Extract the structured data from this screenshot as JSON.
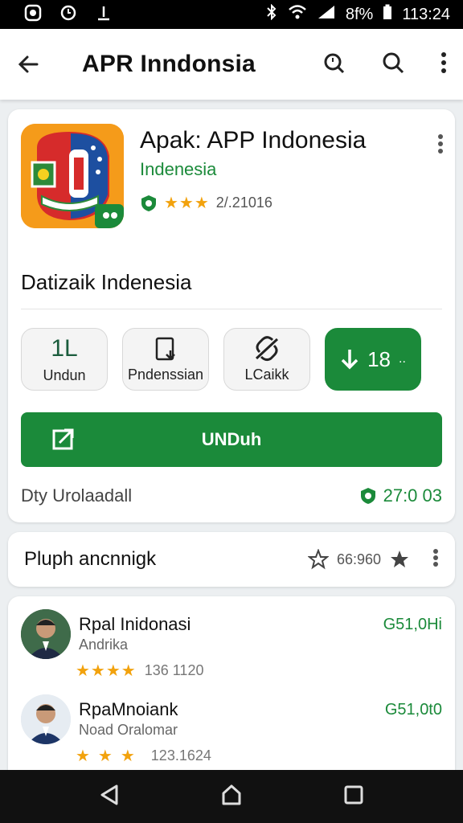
{
  "status_bar": {
    "time": "113:24",
    "battery": "8f%",
    "left_icons": [
      "shield-icon",
      "circle-icon",
      "download-icon"
    ],
    "right_icons": [
      "bluetooth-icon",
      "wifi-icon",
      "signal-icon",
      "battery-icon"
    ]
  },
  "toolbar": {
    "title": "APR Inndonsia"
  },
  "app": {
    "title": "Apak: APP Indonesia",
    "developer": "Indenesia",
    "rating_count": "2/.21016",
    "stars": 3,
    "description": "Datizaik Indenesia",
    "tiles": [
      {
        "value": "1L",
        "label": "Undun"
      },
      {
        "icon": "tablet-download-icon",
        "label": "Pndenssian"
      },
      {
        "icon": "no-link-icon",
        "label": "LCaikk"
      },
      {
        "value": "18",
        "suffix": ".."
      }
    ],
    "install_label": "UNDuh",
    "footer_left": "Dty Urolaadall",
    "footer_right": "27:0 03"
  },
  "sort_bar": {
    "label": "Pluph ancnnigk",
    "count": "66:960"
  },
  "reviews": [
    {
      "name": "Rpal Inidonasi",
      "subtitle": "Andrika",
      "rating_text": "136 1120",
      "price": "G51,0Hi",
      "stars": 4
    },
    {
      "name": "RpaMnoiank",
      "subtitle": "Noad Oralomar",
      "rating_text": "123.1624",
      "price": "G51,0t0",
      "stars": 3
    }
  ],
  "colors": {
    "accent": "#1b8a3a",
    "star": "#f2a20d",
    "icon_bg": "#f59b1a"
  }
}
